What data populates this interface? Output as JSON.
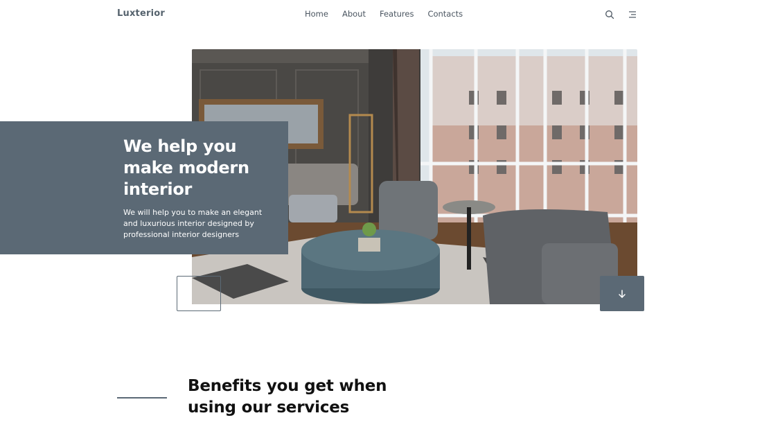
{
  "header": {
    "logo": "Luxterior",
    "nav": [
      "Home",
      "About",
      "Features",
      "Contacts"
    ],
    "icons": {
      "search": "search-icon",
      "menu": "menu-icon"
    }
  },
  "hero": {
    "title": "We help you make modern interior",
    "subtitle": "We will help you to make an elegant and luxurious interior designed by professional interior designers",
    "image": "living-room-photo",
    "scroll_icon": "arrow-down-icon"
  },
  "benefits": {
    "title": "Benefits you get when using our services"
  },
  "colors": {
    "accent": "#5b6975",
    "heading": "#111111",
    "text": "#4a5560"
  }
}
